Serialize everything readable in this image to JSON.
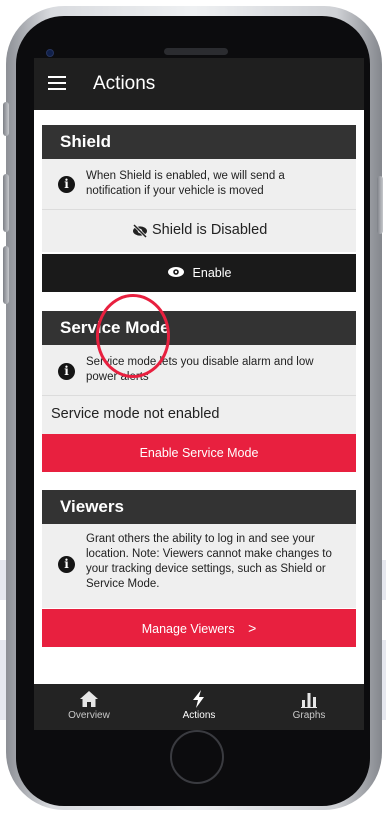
{
  "app_bar": {
    "title": "Actions",
    "menu_icon": "hamburger-menu-icon"
  },
  "shield": {
    "header": "Shield",
    "info_text": "When Shield is enabled, we will send a notification if your vehicle is moved",
    "status_text": "Shield is Disabled",
    "status_icon": "eye-slash-icon",
    "button_label": "Enable",
    "button_icon": "eye-icon"
  },
  "service_mode": {
    "header": "Service Mode",
    "info_text": "Service mode lets you disable alarm and low power alerts",
    "status_text": "Service mode not enabled",
    "button_label": "Enable Service Mode"
  },
  "viewers": {
    "header": "Viewers",
    "info_text": "Grant others the ability to log in and see your location. Note: Viewers cannot make changes to your tracking device settings, such as Shield or Service Mode.",
    "button_label": "Manage Viewers",
    "button_chevron": ">"
  },
  "tabs": [
    {
      "label": "Overview",
      "icon": "home-icon",
      "active": false
    },
    {
      "label": "Actions",
      "icon": "lightning-bolt-icon",
      "active": true
    },
    {
      "label": "Graphs",
      "icon": "bar-chart-icon",
      "active": false
    }
  ],
  "colors": {
    "accent_red": "#e8203f",
    "dark_header": "#333333",
    "app_bar": "#1f1f1f"
  }
}
